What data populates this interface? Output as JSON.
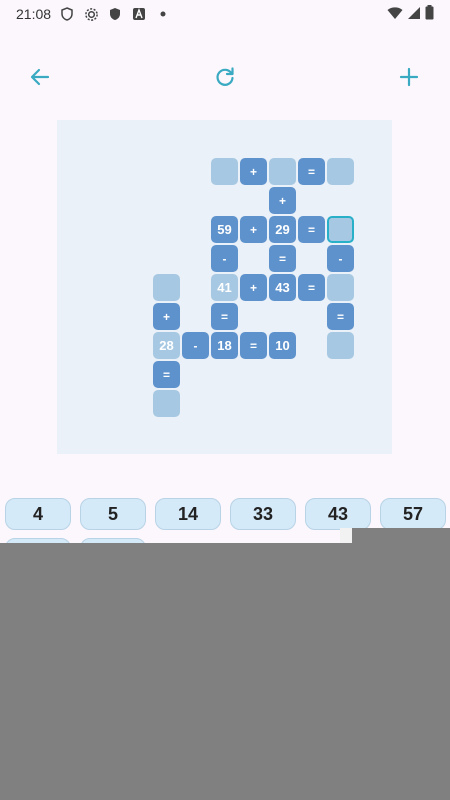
{
  "status": {
    "time": "21:08",
    "icons": [
      "shield-icon",
      "gear-icon",
      "shield-filled-icon",
      "a-letter-icon",
      "dot-icon"
    ],
    "right_icons": [
      "wifi-icon",
      "signal-icon",
      "battery-icon"
    ]
  },
  "toolbar": {
    "back_icon": "arrow-left-icon",
    "refresh_icon": "refresh-icon",
    "add_icon": "plus-icon",
    "accent": "#3aaac2"
  },
  "board": {
    "cells": [
      {
        "kind": "blank",
        "text": ""
      },
      {
        "kind": "op",
        "text": "+"
      },
      {
        "kind": "blank",
        "text": ""
      },
      {
        "kind": "op",
        "text": "="
      },
      {
        "kind": "blank",
        "text": ""
      },
      {
        "kind": "op",
        "text": "+"
      },
      {
        "kind": "num",
        "text": "59"
      },
      {
        "kind": "op",
        "text": "+"
      },
      {
        "kind": "num",
        "text": "29"
      },
      {
        "kind": "op",
        "text": "="
      },
      {
        "kind": "selected",
        "text": ""
      },
      {
        "kind": "op",
        "text": "-"
      },
      {
        "kind": "op",
        "text": "="
      },
      {
        "kind": "op",
        "text": "-"
      },
      {
        "kind": "blank",
        "text": ""
      },
      {
        "kind": "placed",
        "text": "41"
      },
      {
        "kind": "op",
        "text": "+"
      },
      {
        "kind": "num",
        "text": "43"
      },
      {
        "kind": "op",
        "text": "="
      },
      {
        "kind": "blank",
        "text": ""
      },
      {
        "kind": "op",
        "text": "+"
      },
      {
        "kind": "op",
        "text": "="
      },
      {
        "kind": "op",
        "text": "="
      },
      {
        "kind": "placed",
        "text": "28"
      },
      {
        "kind": "op",
        "text": "-"
      },
      {
        "kind": "num",
        "text": "18"
      },
      {
        "kind": "op",
        "text": "="
      },
      {
        "kind": "num",
        "text": "10"
      },
      {
        "kind": "blank",
        "text": ""
      },
      {
        "kind": "op",
        "text": "="
      },
      {
        "kind": "blank",
        "text": ""
      }
    ]
  },
  "tray": {
    "numbers": [
      "4",
      "5",
      "14",
      "33",
      "43",
      "57"
    ],
    "second_row": [
      "",
      ""
    ]
  }
}
